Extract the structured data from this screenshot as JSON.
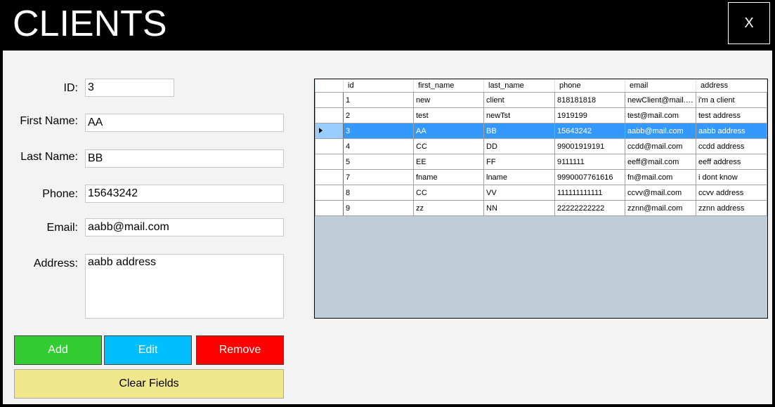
{
  "window": {
    "title": "CLIENTS",
    "close_label": "X"
  },
  "form": {
    "id_label": "ID:",
    "id_value": "3",
    "first_name_label": "First Name:",
    "first_name_value": "AA",
    "last_name_label": "Last Name:",
    "last_name_value": "BB",
    "phone_label": "Phone:",
    "phone_value": "15643242",
    "email_label": "Email:",
    "email_value": "aabb@mail.com",
    "address_label": "Address:",
    "address_value": "aabb address"
  },
  "buttons": {
    "add_label": "Add",
    "add_color": "#33cc33",
    "edit_label": "Edit",
    "edit_color": "#00bfff",
    "remove_label": "Remove",
    "remove_color": "#ff0000",
    "clear_label": "Clear Fields",
    "clear_color": "#f0e68c"
  },
  "grid": {
    "columns": [
      "id",
      "first_name",
      "last_name",
      "phone",
      "email",
      "address"
    ],
    "selected_row_index": 2,
    "selection_color": "#3399ff",
    "rows": [
      [
        "1",
        "new",
        "client",
        "818181818",
        "newClient@mail.c...",
        "i'm a client"
      ],
      [
        "2",
        "test",
        "newTst",
        "1919199",
        "test@mail.com",
        "test address"
      ],
      [
        "3",
        "AA",
        "BB",
        "15643242",
        "aabb@mail.com",
        "aabb address"
      ],
      [
        "4",
        "CC",
        "DD",
        "99001919191",
        "ccdd@mail.com",
        "ccdd address"
      ],
      [
        "5",
        "EE",
        "FF",
        "9111111",
        "eeff@mail.com",
        "eeff address"
      ],
      [
        "7",
        "fname",
        "lname",
        "9990007761616",
        "fn@mail.com",
        "i dont know"
      ],
      [
        "8",
        "CC",
        "VV",
        "111111111111",
        "ccvv@mail.com",
        "ccvv address"
      ],
      [
        "9",
        "zz",
        "NN",
        "22222222222",
        "zznn@mail.com",
        "zznn address"
      ]
    ]
  }
}
